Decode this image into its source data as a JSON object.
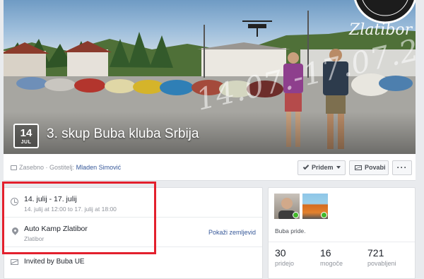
{
  "cover": {
    "watermark": "14.07.-17.07.2016",
    "logo_text": "BEETLE CLUB SERBIA",
    "logo_year": "2013",
    "brand_script": "Zlatibor"
  },
  "event": {
    "date_day": "14",
    "date_month": "JUL",
    "title": "3. skup Buba kluba Srbija"
  },
  "header": {
    "privacy_label": "Zasebno",
    "host_prefix": "· Gostitelj:",
    "host_name": "Mladen Simović",
    "going_button": "Pridem",
    "share_button": "Povabi",
    "more_button": "···"
  },
  "details": {
    "date_range": "14. julij - 17. julij",
    "time_range": "14. julij at 12:00 to 17. julij at 18:00",
    "location_name": "Auto Kamp Zlatibor",
    "location_sub": "Zlatibor",
    "map_link": "Pokaži zemljevid",
    "invited_by": "Invited by Buba UE"
  },
  "attendees": {
    "note": "Buba pride.",
    "stats": [
      {
        "count": "30",
        "label": "pridejo"
      },
      {
        "count": "16",
        "label": "mogoče"
      },
      {
        "count": "721",
        "label": "povabljeni"
      }
    ]
  },
  "colors": {
    "link": "#365899",
    "highlight_box": "#e3202d",
    "going_badge": "#42b72a"
  },
  "icons": {
    "privacy": "lock-icon",
    "going": "check-icon",
    "share": "envelope-icon",
    "time": "clock-icon",
    "location": "map-pin-icon",
    "invite": "envelope-icon"
  }
}
